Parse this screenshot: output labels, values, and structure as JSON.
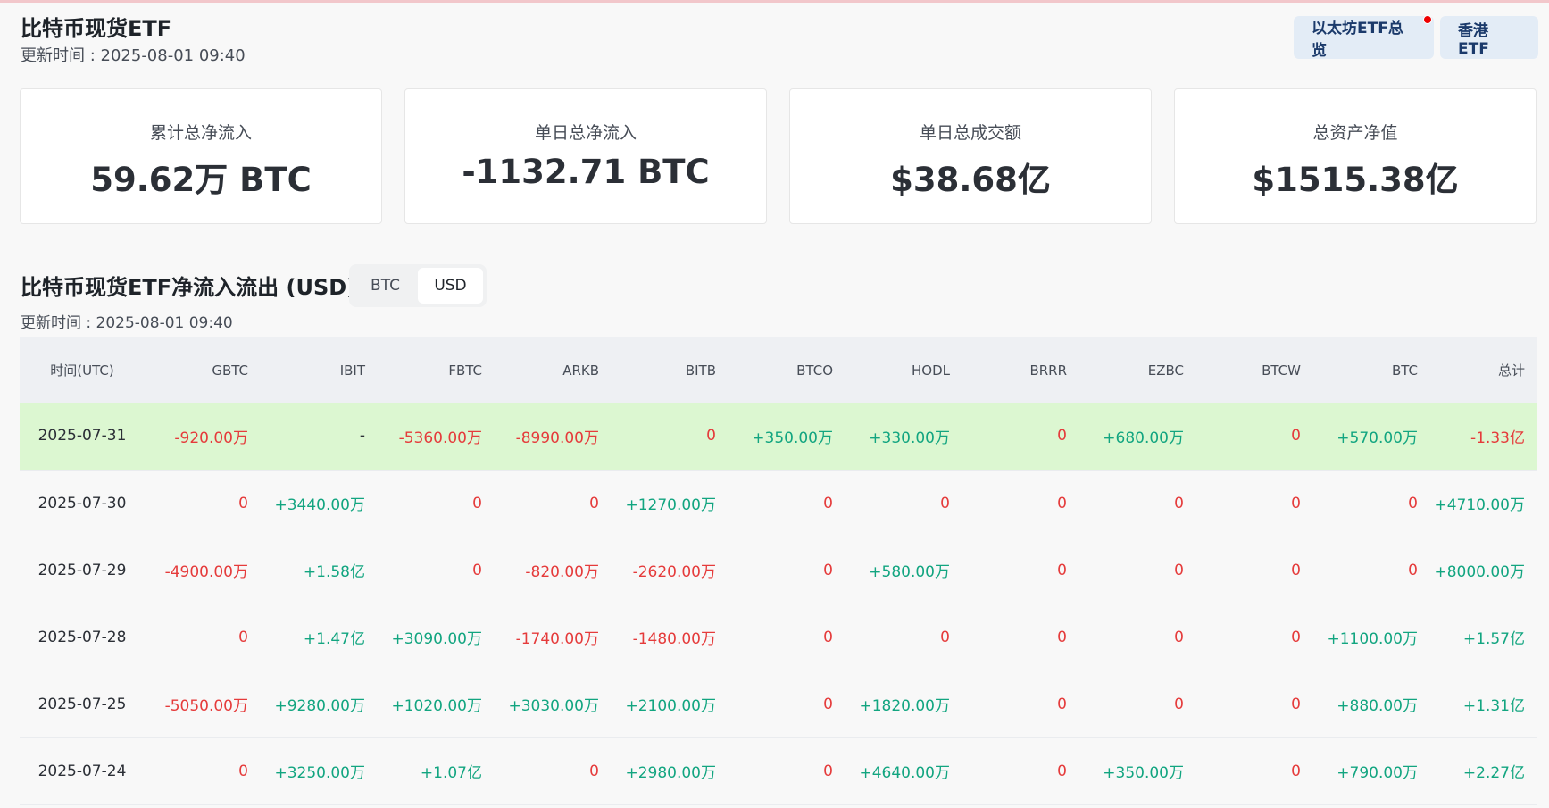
{
  "header": {
    "title": "比特币现货ETF",
    "update_time": "更新时间 : 2025-08-01 09:40",
    "buttons": [
      "以太坊ETF总览",
      "香港 ETF"
    ]
  },
  "cards": [
    {
      "label": "累计总净流入",
      "value": "59.62万 BTC"
    },
    {
      "label": "单日总净流入",
      "value": "-1132.71 BTC"
    },
    {
      "label": "单日总成交额",
      "value": "$38.68亿"
    },
    {
      "label": "总资产净值",
      "value": "$1515.38亿"
    }
  ],
  "section": {
    "title": "比特币现货ETF净流入流出 (USD)",
    "update_time": "更新时间 : 2025-08-01 09:40",
    "toggle": {
      "options": [
        "BTC",
        "USD"
      ],
      "selected": "USD"
    }
  },
  "colors": {
    "positive": "#12a580",
    "negative": "#e53b3b",
    "highlight_row": "#dcf7d1"
  },
  "table": {
    "columns": [
      "时间(UTC)",
      "GBTC",
      "IBIT",
      "FBTC",
      "ARKB",
      "BITB",
      "BTCO",
      "HODL",
      "BRRR",
      "EZBC",
      "BTCW",
      "BTC",
      "总计"
    ],
    "rows": [
      [
        "2025-07-31",
        "-920.00万",
        "-",
        "-5360.00万",
        "-8990.00万",
        "0",
        "+350.00万",
        "+330.00万",
        "0",
        "+680.00万",
        "0",
        "+570.00万",
        "-1.33亿"
      ],
      [
        "2025-07-30",
        "0",
        "+3440.00万",
        "0",
        "0",
        "+1270.00万",
        "0",
        "0",
        "0",
        "0",
        "0",
        "0",
        "+4710.00万"
      ],
      [
        "2025-07-29",
        "-4900.00万",
        "+1.58亿",
        "0",
        "-820.00万",
        "-2620.00万",
        "0",
        "+580.00万",
        "0",
        "0",
        "0",
        "0",
        "+8000.00万"
      ],
      [
        "2025-07-28",
        "0",
        "+1.47亿",
        "+3090.00万",
        "-1740.00万",
        "-1480.00万",
        "0",
        "0",
        "0",
        "0",
        "0",
        "+1100.00万",
        "+1.57亿"
      ],
      [
        "2025-07-25",
        "-5050.00万",
        "+9280.00万",
        "+1020.00万",
        "+3030.00万",
        "+2100.00万",
        "0",
        "+1820.00万",
        "0",
        "0",
        "0",
        "+880.00万",
        "+1.31亿"
      ],
      [
        "2025-07-24",
        "0",
        "+3250.00万",
        "+1.07亿",
        "0",
        "+2980.00万",
        "0",
        "+4640.00万",
        "0",
        "+350.00万",
        "0",
        "+790.00万",
        "+2.27亿"
      ]
    ]
  }
}
